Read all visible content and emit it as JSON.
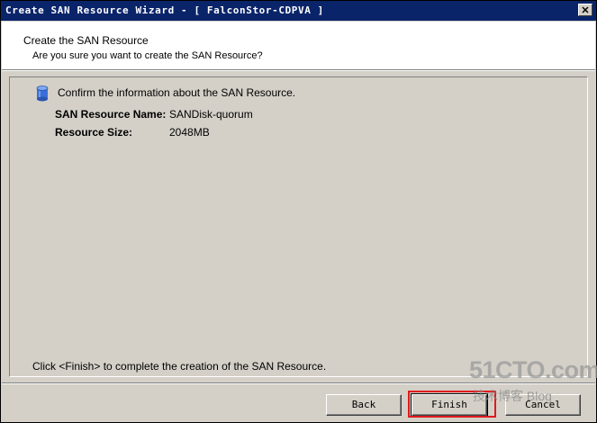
{
  "window": {
    "title": "Create SAN Resource Wizard - [ FalconStor-CDPVA ]",
    "close_glyph": "✕"
  },
  "header": {
    "title": "Create the SAN Resource",
    "subtitle": "Are you sure you want to create the SAN Resource?"
  },
  "content": {
    "icon": "database-icon",
    "confirm_text": "Confirm the information about the SAN Resource.",
    "fields": [
      {
        "label": "SAN Resource Name:",
        "value": "SANDisk-quorum"
      },
      {
        "label": "Resource Size:",
        "value": "2048MB"
      }
    ],
    "footer_text": "Click <Finish> to complete the creation of the SAN Resource."
  },
  "buttons": {
    "back": "Back",
    "finish": "Finish",
    "cancel": "Cancel"
  },
  "watermark": {
    "logo": "51CTO.com",
    "tagline": "技术博客 Blog"
  },
  "colors": {
    "titlebar": "#0a246a",
    "highlight": "#e0191c",
    "icon": "#3a6fd8"
  }
}
